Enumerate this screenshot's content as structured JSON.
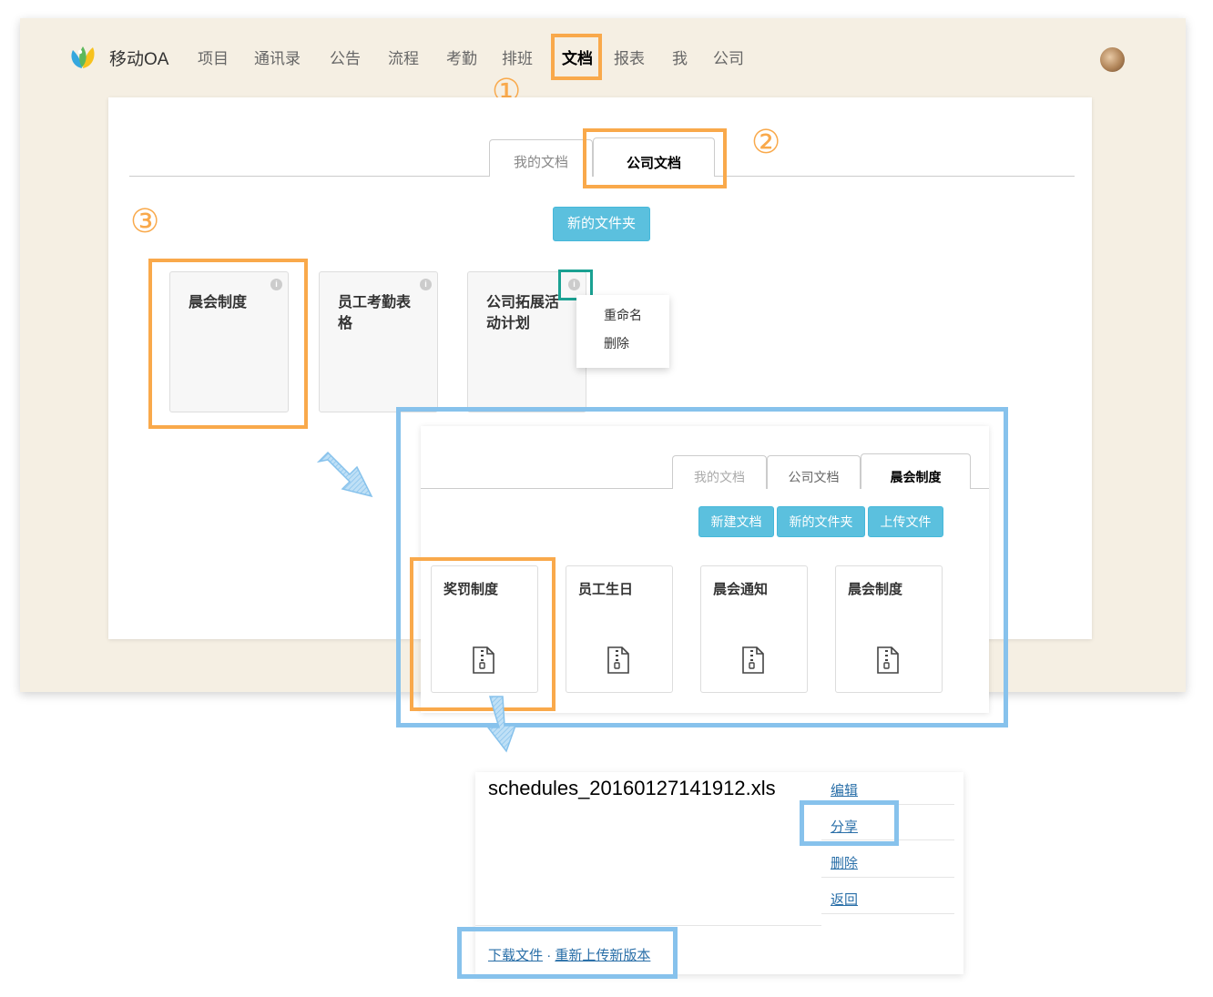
{
  "nav": {
    "brand": "移动OA",
    "items": [
      "项目",
      "通讯录",
      "公告",
      "流程",
      "考勤",
      "排班",
      "文档",
      "报表",
      "我",
      "公司"
    ],
    "active": "文档"
  },
  "tabs": {
    "my_docs": "我的文档",
    "company_docs": "公司文档"
  },
  "toolbar": {
    "new_folder": "新的文件夹"
  },
  "folders": [
    "晨会制度",
    "员工考勤表格",
    "公司拓展活动计划"
  ],
  "context_menu": {
    "rename": "重命名",
    "delete": "删除"
  },
  "markers": {
    "one": "①",
    "two": "②",
    "three": "③"
  },
  "detail": {
    "tabs": {
      "my_docs": "我的文档",
      "company_docs": "公司文档",
      "current": "晨会制度"
    },
    "buttons": {
      "new_doc": "新建文档",
      "new_folder": "新的文件夹",
      "upload": "上传文件"
    },
    "files": [
      "奖罚制度",
      "员工生日",
      "晨会通知",
      "晨会制度"
    ]
  },
  "file_view": {
    "filename": "schedules_20160127141912.xls",
    "actions": {
      "edit": "编辑",
      "share": "分享",
      "delete": "删除",
      "back": "返回"
    },
    "download": "下载文件",
    "separator": "·",
    "reupload": "重新上传新版本"
  },
  "colors": {
    "highlight_orange": "#f9a94b",
    "highlight_blue": "#87c2ec",
    "highlight_teal": "#1aa192",
    "button_blue": "#5bc0de",
    "link_blue": "#2a6fa8"
  }
}
